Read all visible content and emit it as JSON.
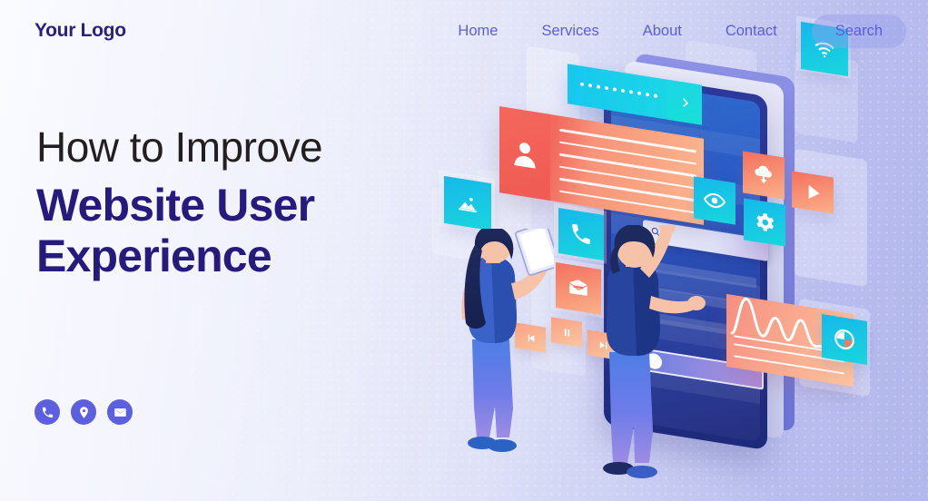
{
  "header": {
    "logo": "Your Logo",
    "nav": [
      {
        "label": "Home",
        "name": "nav-home"
      },
      {
        "label": "Services",
        "name": "nav-services"
      },
      {
        "label": "About",
        "name": "nav-about"
      },
      {
        "label": "Contact",
        "name": "nav-contact"
      }
    ],
    "search_label": "Search"
  },
  "hero": {
    "line1": "How to Improve",
    "line2": "Website User",
    "line3": "Experience"
  },
  "socials": [
    {
      "icon": "phone-icon",
      "name": "social-phone"
    },
    {
      "icon": "location-icon",
      "name": "social-location"
    },
    {
      "icon": "email-icon",
      "name": "social-email"
    }
  ],
  "illustration": {
    "alt": "Two people interacting with floating user-interface cards around a large tablet",
    "tiles": [
      {
        "icon": "image-icon",
        "color": "cyan"
      },
      {
        "icon": "phone-icon",
        "color": "cyan"
      },
      {
        "icon": "mail-icon",
        "color": "orange"
      },
      {
        "icon": "wifi-icon",
        "color": "cyan"
      },
      {
        "icon": "cloud-download-icon",
        "color": "orange"
      },
      {
        "icon": "play-icon",
        "color": "orange"
      },
      {
        "icon": "eye-icon",
        "color": "cyan"
      },
      {
        "icon": "gear-icon",
        "color": "cyan"
      },
      {
        "icon": "pie-chart-icon",
        "color": "cyan"
      }
    ],
    "media_controls": [
      {
        "icon": "previous-icon"
      },
      {
        "icon": "pause-icon"
      },
      {
        "icon": "next-icon"
      }
    ],
    "password_field": {
      "masked_value": "••••••••••",
      "submit_icon": "chevron-right-icon"
    },
    "tablet_search": {
      "icon": "search-icon"
    }
  },
  "colors": {
    "brand_navy": "#251a7e",
    "brand_purple": "#5b5fe0",
    "nav_text": "#5b5fd6",
    "headline_dark": "#231f20",
    "accent_cyan": "#16c7ef",
    "accent_orange": "#f4705f"
  }
}
